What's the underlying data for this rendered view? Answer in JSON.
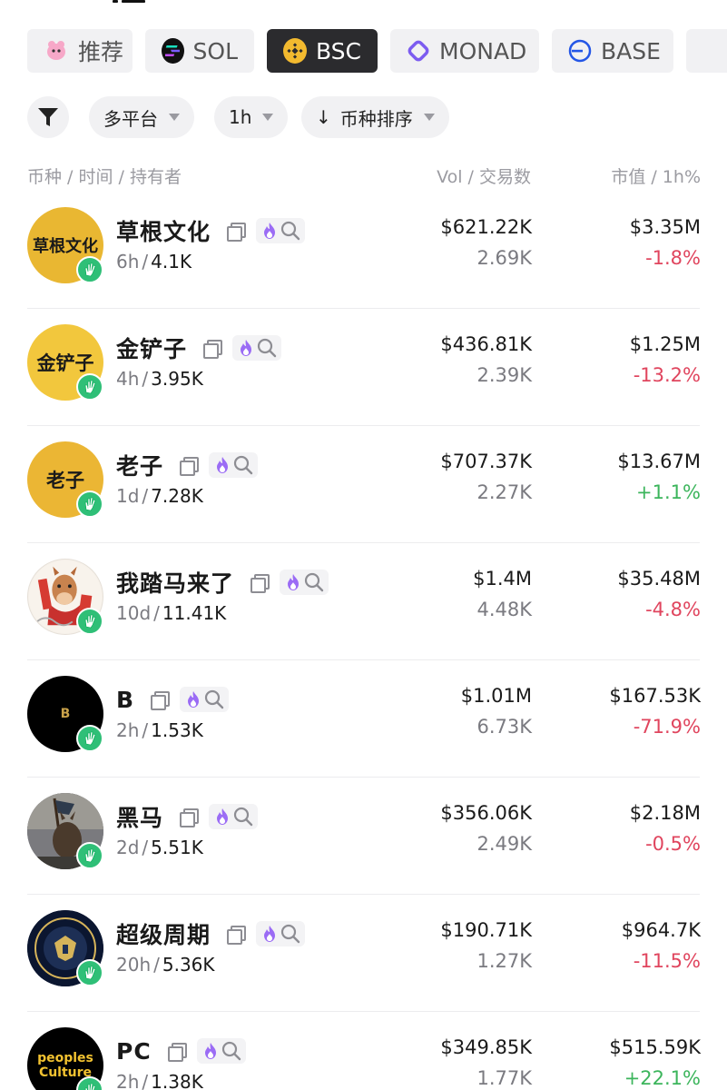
{
  "chain_tabs": [
    {
      "label": "推荐",
      "icon": "recommend-icon",
      "active": false
    },
    {
      "label": "SOL",
      "icon": "sol-icon",
      "active": false
    },
    {
      "label": "BSC",
      "icon": "bnb-icon",
      "active": true
    },
    {
      "label": "MONAD",
      "icon": "monad-icon",
      "active": false
    },
    {
      "label": "BASE",
      "icon": "base-icon",
      "active": false
    }
  ],
  "filters": {
    "platform": "多平台",
    "interval": "1h",
    "sort": "币种排序"
  },
  "columns": {
    "left": "币种 / 时间 / 持有者",
    "mid": "Vol / 交易数",
    "right": "市值 / 1h%"
  },
  "tokens": [
    {
      "name": "草根文化",
      "avatar_text": "草根文化",
      "age": "6h",
      "holders": "4.1K",
      "vol": "$621.22K",
      "tx": "2.69K",
      "mcap": "$3.35M",
      "change": "-1.8%",
      "direction": "down"
    },
    {
      "name": "金铲子",
      "avatar_text": "金铲子",
      "age": "4h",
      "holders": "3.95K",
      "vol": "$436.81K",
      "tx": "2.39K",
      "mcap": "$1.25M",
      "change": "-13.2%",
      "direction": "down"
    },
    {
      "name": "老子",
      "avatar_text": "老子",
      "age": "1d",
      "holders": "7.28K",
      "vol": "$707.37K",
      "tx": "2.27K",
      "mcap": "$13.67M",
      "change": "+1.1%",
      "direction": "up"
    },
    {
      "name": "我踏马来了",
      "avatar_text": "",
      "age": "10d",
      "holders": "11.41K",
      "vol": "$1.4M",
      "tx": "4.48K",
      "mcap": "$35.48M",
      "change": "-4.8%",
      "direction": "down"
    },
    {
      "name": "B",
      "avatar_text": "B",
      "age": "2h",
      "holders": "1.53K",
      "vol": "$1.01M",
      "tx": "6.73K",
      "mcap": "$167.53K",
      "change": "-71.9%",
      "direction": "down"
    },
    {
      "name": "黑马",
      "avatar_text": "",
      "age": "2d",
      "holders": "5.51K",
      "vol": "$356.06K",
      "tx": "2.49K",
      "mcap": "$2.18M",
      "change": "-0.5%",
      "direction": "down"
    },
    {
      "name": "超级周期",
      "avatar_text": "",
      "age": "20h",
      "holders": "5.36K",
      "vol": "$190.71K",
      "tx": "1.27K",
      "mcap": "$964.7K",
      "change": "-11.5%",
      "direction": "down"
    },
    {
      "name": "PC",
      "avatar_text": "peoples Culture",
      "age": "2h",
      "holders": "1.38K",
      "vol": "$349.85K",
      "tx": "1.77K",
      "mcap": "$515.59K",
      "change": "+22.1%",
      "direction": "up"
    }
  ],
  "colors": {
    "accent_purple": "#8b5cf6",
    "negative": "#e0455e",
    "positive": "#3cb55c",
    "badge_green": "#2fbf77",
    "active_tab": "#2b2b2e"
  }
}
